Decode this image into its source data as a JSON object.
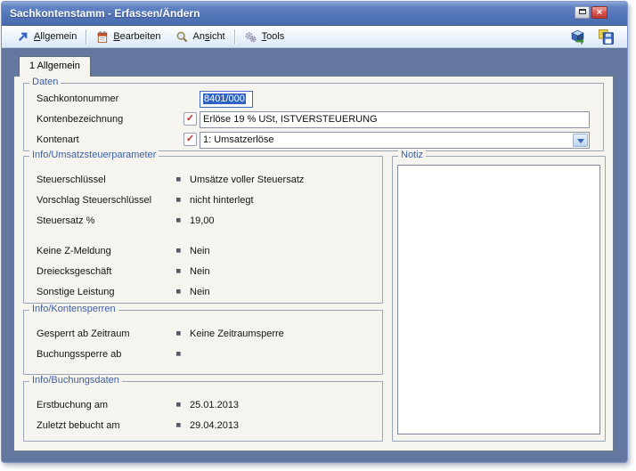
{
  "window": {
    "title": "Sachkontenstamm - Erfassen/Ändern",
    "close_glyph": "×"
  },
  "toolbar": {
    "menus": [
      {
        "pre": "",
        "key": "A",
        "post": "llgemein",
        "icon": "arrow-up-right-icon"
      },
      {
        "pre": "",
        "key": "B",
        "post": "earbeiten",
        "icon": "notepad-icon"
      },
      {
        "pre": "An",
        "key": "s",
        "post": "icht",
        "icon": "magnifier-icon"
      },
      {
        "pre": "",
        "key": "T",
        "post": "ools",
        "icon": "gears-icon"
      }
    ],
    "right_buttons": [
      {
        "icon": "package-icon"
      },
      {
        "icon": "save-icon"
      }
    ]
  },
  "tab": {
    "label": "1 Allgemein"
  },
  "icons": {
    "check": "✓"
  },
  "groups": {
    "daten": {
      "title": "Daten",
      "fields": [
        {
          "label": "Sachkontonummer",
          "value": "8401/000"
        },
        {
          "label": "Kontenbezeichnung",
          "value": "Erlöse 19 % USt, ISTVERSTEUERUNG"
        },
        {
          "label": "Kontenart",
          "value": "1: Umsatzerlöse"
        }
      ]
    },
    "umsatzsteuer": {
      "title": "Info/Umsatzsteuerparameter",
      "rows": [
        {
          "label": "Steuerschlüssel",
          "value": "Umsätze voller Steuersatz"
        },
        {
          "label": "Vorschlag Steuerschlüssel",
          "value": "nicht hinterlegt"
        },
        {
          "label": "Steuersatz %",
          "value": "19,00"
        },
        {
          "label": "Keine Z-Meldung",
          "value": "Nein"
        },
        {
          "label": "Dreiecksgeschäft",
          "value": "Nein"
        },
        {
          "label": "Sonstige Leistung",
          "value": "Nein"
        }
      ]
    },
    "kontensperren": {
      "title": "Info/Kontensperren",
      "rows": [
        {
          "label": "Gesperrt ab Zeitraum",
          "value": "Keine Zeitraumsperre"
        },
        {
          "label": "Buchungssperre ab",
          "value": ""
        }
      ]
    },
    "buchungsdaten": {
      "title": "Info/Buchungsdaten",
      "rows": [
        {
          "label": "Erstbuchung am",
          "value": "25.01.2013"
        },
        {
          "label": "Zuletzt bebucht am",
          "value": "29.04.2013"
        }
      ]
    },
    "notiz": {
      "title": "Notiz",
      "value": ""
    }
  },
  "colors": {
    "titlebar_blue": "#5376ba",
    "frame_slate": "#64779e",
    "panel_cream": "#f5f4ee",
    "selection_blue": "#2e62c4",
    "group_title_blue": "#3d5fa6",
    "close_red": "#c2423d",
    "check_red": "#cf1f1f"
  }
}
